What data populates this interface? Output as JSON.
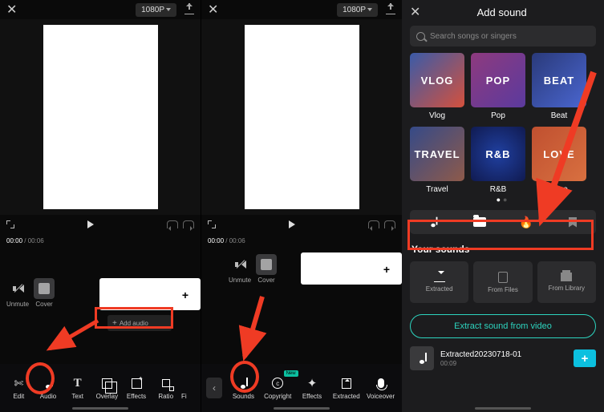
{
  "screen1": {
    "resolution": "1080P",
    "time_current": "00:00",
    "time_total": "00:06",
    "unmute": "Unmute",
    "cover": "Cover",
    "add_audio": "Add audio",
    "toolbar": [
      "Edit",
      "Audio",
      "Text",
      "Overlay",
      "Effects",
      "Ratio",
      "Fi"
    ]
  },
  "screen2": {
    "resolution": "1080P",
    "time_current": "00:00",
    "time_total": "00:06",
    "unmute": "Unmute",
    "cover": "Cover",
    "new_tag": "New",
    "toolbar": [
      "Sounds",
      "Copyright",
      "Effects",
      "Extracted",
      "Voiceover"
    ]
  },
  "screen3": {
    "title": "Add sound",
    "search_placeholder": "Search songs or singers",
    "categories": [
      {
        "label": "Vlog",
        "text": "VLOG"
      },
      {
        "label": "Pop",
        "text": "POP"
      },
      {
        "label": "Beat",
        "text": "BEAT"
      },
      {
        "label": "Travel",
        "text": "TRAVEL"
      },
      {
        "label": "R&B",
        "text": "R&B"
      },
      {
        "label": "Love",
        "text": "LOVE"
      }
    ],
    "your_sounds": "Your sounds",
    "cards": [
      "Extracted",
      "From Files",
      "From Library"
    ],
    "extract_btn": "Extract sound from video",
    "sound": {
      "name": "Extracted20230718-01",
      "duration": "00:09"
    }
  }
}
